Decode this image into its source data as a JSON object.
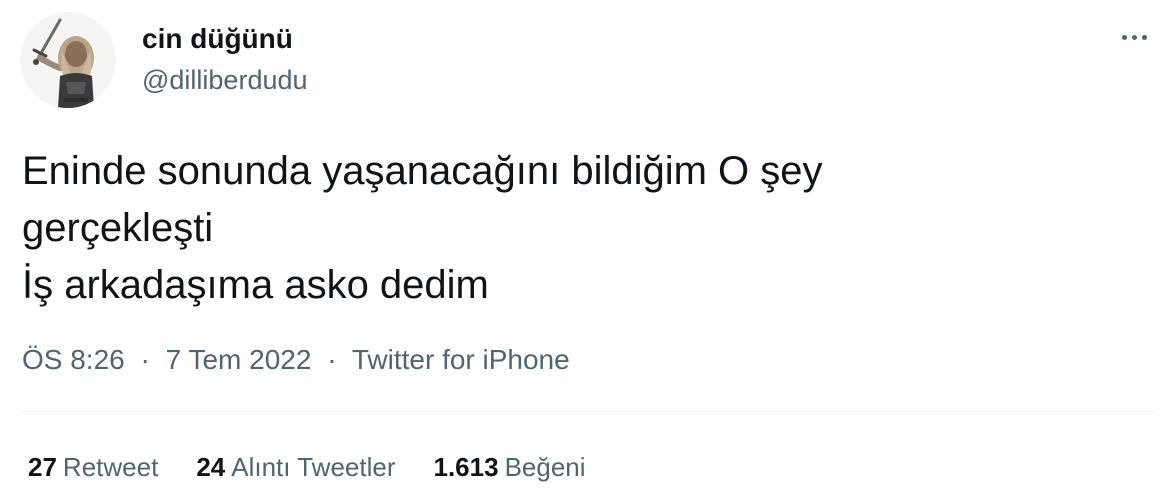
{
  "author": {
    "display_name": "cin düğünü",
    "handle": "@dilliberdudu",
    "avatar_icon": "warrior-with-sword-avatar"
  },
  "more_icon": "more-dots-icon",
  "tweet": {
    "lines": [
      "Eninde sonunda yaşanacağını bildiğim O şey",
      "gerçekleşti",
      "İş arkadaşıma asko dedim"
    ]
  },
  "meta": {
    "time": "ÖS 8:26",
    "separator": "·",
    "date": "7 Tem 2022",
    "source": "Twitter for iPhone"
  },
  "stats": {
    "retweets": {
      "count": "27",
      "label": "Retweet"
    },
    "quotes": {
      "count": "24",
      "label": "Alıntı Tweetler"
    },
    "likes": {
      "count": "1.613",
      "label": "Beğeni"
    }
  },
  "colors": {
    "text": "#0f1419",
    "secondary": "#536471",
    "divider": "#eff3f4"
  }
}
